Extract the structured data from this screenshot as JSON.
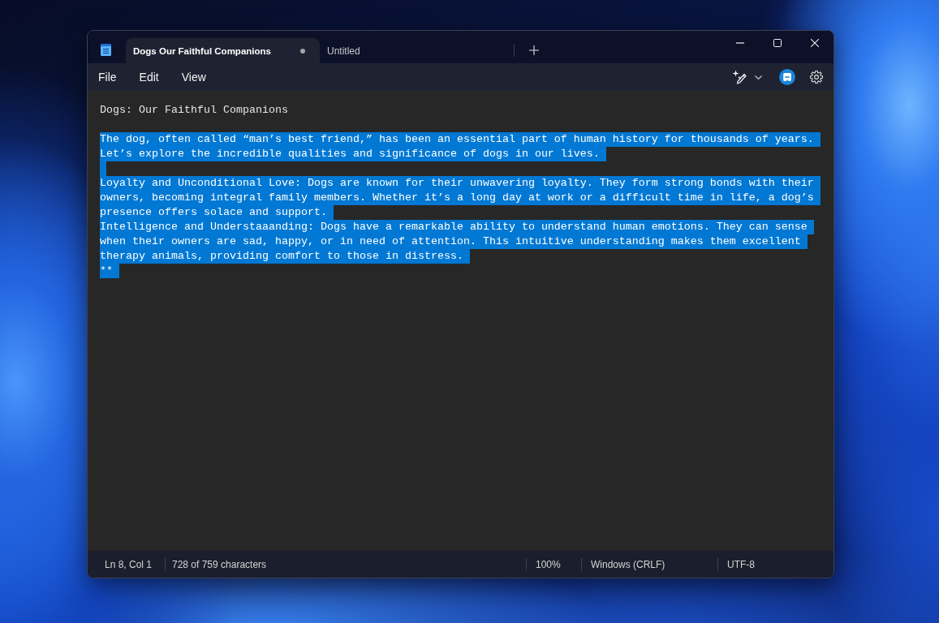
{
  "window": {
    "tabs": [
      {
        "title": "Dogs Our Faithful Companions",
        "selected": true,
        "unsaved": true
      },
      {
        "title": "Untitled",
        "selected": false,
        "unsaved": false
      }
    ]
  },
  "menu": [
    {
      "label": "File"
    },
    {
      "label": "Edit"
    },
    {
      "label": "View"
    }
  ],
  "editor": {
    "lines": [
      {
        "kind": "text",
        "text": "Dogs: Our Faithful Companions",
        "selected": false
      },
      {
        "kind": "blank",
        "selected": false
      },
      {
        "kind": "text",
        "text": "The dog, often called “man’s best friend,” has been an essential part of human history for thousands of years.",
        "selected": true
      },
      {
        "kind": "text",
        "text": "Let’s explore the incredible qualities and significance of dogs in our lives.",
        "selected": true
      },
      {
        "kind": "blank",
        "selected": true
      },
      {
        "kind": "text",
        "text": "Loyalty and Unconditional Love: Dogs are known for their unwavering loyalty. They form strong bonds with their",
        "selected": true
      },
      {
        "kind": "text",
        "text": "owners, becoming integral family members. Whether it’s a long day at work or a difficult time in life, a dog’s",
        "selected": true
      },
      {
        "kind": "text",
        "text": "presence offers solace and support.",
        "selected": true
      },
      {
        "kind": "text",
        "text": "Intelligence and Understaaanding: Dogs have a remarkable ability to understand human emotions. They can sense",
        "selected": true
      },
      {
        "kind": "text",
        "text": "when their owners are sad, happy, or in need of attention. This intuitive understanding makes them excellent",
        "selected": true
      },
      {
        "kind": "text",
        "text": "therapy animals, providing comfort to those in distress.",
        "selected": true
      },
      {
        "kind": "text",
        "text": "**",
        "selected": true
      }
    ]
  },
  "status_bar": {
    "position": "Ln 8, Col 1",
    "characters": "728 of 759 characters",
    "zoom": "100%",
    "line_ending": "Windows (CRLF)",
    "encoding": "UTF-8"
  }
}
